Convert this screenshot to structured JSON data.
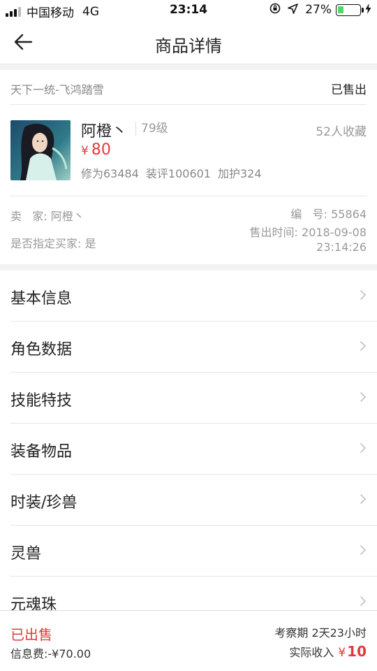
{
  "status_bar": {
    "carrier": "中国移动",
    "network": "4G",
    "time": "23:14",
    "battery": "27%",
    "battery_level": 0.27,
    "icons": [
      "signal-icon",
      "lock-rotation-icon",
      "location-arrow-icon",
      "battery-icon",
      "charging-bolt-icon"
    ]
  },
  "nav": {
    "title": "商品详情",
    "back_icon": "arrow-left-icon"
  },
  "product": {
    "server": "天下一统-飞鸿踏雪",
    "sale_state": "已售出",
    "role_name": "阿橙丶",
    "level": "79级",
    "favorites": "52人收藏",
    "currency": "¥",
    "price": "80",
    "stat_cultivation": "修为63484",
    "stat_equip_score": "装评100601",
    "stat_defense": "加护324",
    "seller_label": "卖   家: 阿橙丶",
    "serial_label": "编   号: 55864",
    "designated_label": "是否指定买家: 是",
    "sold_time_label": "售出时间: 2018-09-08",
    "sold_time_clock": "23:14:26"
  },
  "menu": [
    {
      "label": "基本信息"
    },
    {
      "label": "角色数据"
    },
    {
      "label": "技能特技"
    },
    {
      "label": "装备物品"
    },
    {
      "label": "时装/珍兽"
    },
    {
      "label": "灵兽"
    },
    {
      "label": "元魂珠"
    }
  ],
  "bottom": {
    "status": "已出售",
    "fee": "信息费:-¥70.00",
    "period": "考察期 2天23小时",
    "income_label": "实际收入",
    "income_currency": "¥",
    "income_amount": "10"
  },
  "colors": {
    "accent_red": "#e5383b",
    "divider": "#e6e6e6",
    "section_gap": "#f2f2f2",
    "battery_green": "#4cd964"
  }
}
